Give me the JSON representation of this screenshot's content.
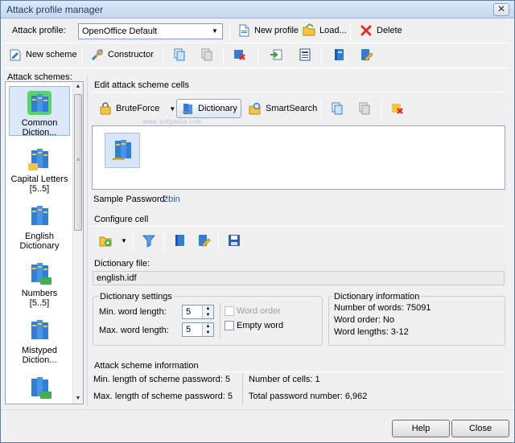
{
  "window": {
    "title": "Attack profile manager",
    "close_glyph": "✕"
  },
  "profile_bar": {
    "label": "Attack profile:",
    "selected": "OpenOffice Default",
    "new_profile": "New profile",
    "load": "Load...",
    "delete": "Delete"
  },
  "scheme_toolbar": {
    "new_scheme": "New scheme",
    "constructor": "Constructor"
  },
  "attack_schemes": {
    "label": "Attack schemes:",
    "items": [
      {
        "line1": "Common",
        "line2": "Diction..."
      },
      {
        "line1": "Capital Letters",
        "line2": "[5..5]"
      },
      {
        "line1": "English",
        "line2": "Dictionary"
      },
      {
        "line1": "Numbers",
        "line2": "[5..5]"
      },
      {
        "line1": "Mistyped",
        "line2": "Diction..."
      }
    ]
  },
  "edit_cells": {
    "title": "Edit attack scheme cells",
    "bruteforce": "BruteForce",
    "dictionary": "Dictionary",
    "smartsearch": "SmartSearch",
    "watermark": "www.softpedia.com"
  },
  "sample_password": {
    "label": "Sample Password:",
    "value": "2bin"
  },
  "configure_cell": {
    "title": "Configure cell"
  },
  "dictionary_file": {
    "label": "Dictionary file:",
    "value": "english.idf"
  },
  "dictionary_settings": {
    "title": "Dictionary settings",
    "min_label": "Min. word length:",
    "min_value": "5",
    "max_label": "Max. word length:",
    "max_value": "5",
    "word_order": "Word order",
    "empty_word": "Empty word"
  },
  "dictionary_info": {
    "title": "Dictionary information",
    "words": "Number of words: 75091",
    "order": "Word order: No",
    "lengths": "Word lengths: 3-12"
  },
  "scheme_info": {
    "title": "Attack scheme information",
    "min_len": "Min. length of scheme password: 5",
    "max_len": "Max. length of scheme password: 5",
    "cells": "Number of cells: 1",
    "total": "Total password number: 6,962"
  },
  "footer": {
    "help": "Help",
    "close": "Close"
  },
  "colors": {
    "accent": "#2a5db0",
    "selection": "#dbe8f7",
    "book_blue": "#2f7fd6",
    "book_yellow": "#f5c542"
  }
}
